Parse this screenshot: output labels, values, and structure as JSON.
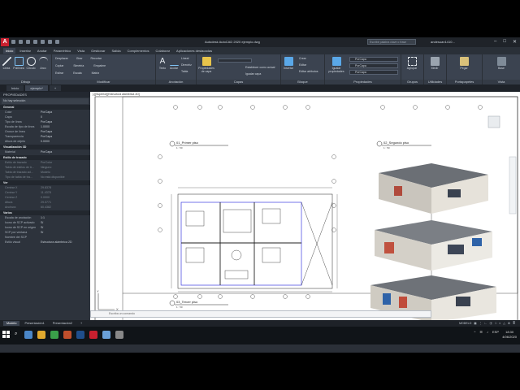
{
  "window": {
    "logo": "A",
    "title": "Autodesk AutoCAD 2020   ejemplo.dwg",
    "search_placeholder": "Escribir palabra clave o frase",
    "user": "andesuan1410...",
    "winbtns": [
      "–",
      "□",
      "✕"
    ]
  },
  "ribbon_tabs": [
    "Inicio",
    "Insertar",
    "Anotar",
    "Paramétrico",
    "Vista",
    "Gestionar",
    "Salida",
    "Complementos",
    "Colaborar",
    "Aplicaciones destacadas"
  ],
  "ribbon": {
    "dibujo": {
      "title": "Dibujo",
      "buttons": [
        "Línea",
        "Polilínea",
        "Círculo",
        "Arco"
      ]
    },
    "modificar": {
      "title": "Modificar",
      "rows": [
        [
          "Desplazar",
          "Girar",
          "Recortar"
        ],
        [
          "Copiar",
          "Simetría",
          "Empalme"
        ],
        [
          "Estirar",
          "Escala",
          "Matriz"
        ]
      ]
    },
    "anotacion": {
      "title": "Anotación",
      "buttons": [
        "Texto",
        "Acotar"
      ],
      "rows": [
        "Lineal",
        "Directriz",
        "Tabla"
      ]
    },
    "capas": {
      "title": "Capas",
      "big": "Propiedades de capa",
      "rows": [
        "Establecer como actual",
        "Igualar capa"
      ]
    },
    "bloque": {
      "title": "Bloque",
      "big": "Insertar",
      "rows": [
        "Crear",
        "Editar",
        "Editar atributos"
      ]
    },
    "propiedades": {
      "title": "Propiedades",
      "big": "Igualar propiedades",
      "values": [
        "PorCapa",
        "PorCapa",
        "PorCapa"
      ]
    },
    "grupos": {
      "title": "Grupos",
      "big": "Agrupar"
    },
    "utilidades": {
      "title": "Utilidades",
      "big": "Medir"
    },
    "portapapeles": {
      "title": "Portapapeles",
      "big": "Pegar"
    },
    "vista": {
      "title": "Vista",
      "big": "Base"
    }
  },
  "doc_tabs": [
    "Inicio",
    "ejemplo*",
    "+"
  ],
  "properties": {
    "header": "PROPIEDADES",
    "selection": "No hay selección",
    "sections": [
      {
        "name": "General",
        "rows": [
          [
            "Color",
            "PorCapa"
          ],
          [
            "Capa",
            "0"
          ],
          [
            "Tipo de línea",
            "PorCapa"
          ],
          [
            "Escala de tipo de línea",
            "1.0000"
          ],
          [
            "Grosor de línea",
            "PorCapa"
          ],
          [
            "Transparencia",
            "PorCapa"
          ],
          [
            "Altura de objeto",
            "0.0000"
          ]
        ]
      },
      {
        "name": "Visualización 3D",
        "rows": [
          [
            "Material",
            "PorCapa"
          ]
        ]
      },
      {
        "name": "Estilo de trazado",
        "rows": [
          [
            "Estilo de trazado",
            "PorColor"
          ],
          [
            "Tabla de estilos de tr...",
            "Ninguno"
          ],
          [
            "Tabla de trazado ad...",
            "Modelo"
          ],
          [
            "Tipo de tabla de tra...",
            "No está disponible"
          ]
        ]
      },
      {
        "name": "Ver",
        "rows": [
          [
            "Centrar X",
            "29.8378"
          ],
          [
            "Centrar Y",
            "11.4378"
          ],
          [
            "Centrar Z",
            "0.0000"
          ],
          [
            "Altura",
            "29.0771"
          ],
          [
            "Anchura",
            "60.4382"
          ]
        ]
      },
      {
        "name": "Varios",
        "rows": [
          [
            "Escala de anotación",
            "1:1"
          ],
          [
            "Icono de SCP activado",
            "Sí"
          ],
          [
            "Icono de SCP en origen",
            "Sí"
          ],
          [
            "SCP por ventana",
            "Sí"
          ],
          [
            "Nombre del SCP",
            ""
          ],
          [
            "Estilo visual",
            "Estructura alámbrica 2D"
          ]
        ]
      }
    ]
  },
  "canvas": {
    "viewport_label": "[-][Superior][Estructura alámbrica 2D]",
    "plan1": "01_Primer piso",
    "plan2": "02_Segundo piso",
    "plan3": "03_Tercer piso",
    "scale": "1 : 50",
    "axis_x": "X",
    "axis_y": "Y"
  },
  "command": {
    "placeholder": "Escriba un comando"
  },
  "layout_tabs": [
    "Modelo",
    "Presentación1",
    "Presentación2",
    "+"
  ],
  "status": {
    "model": "MODELO"
  },
  "taskbar": {
    "time": "18:30",
    "date": "4/06/2020",
    "lang": "ESP"
  },
  "colors": {
    "accent": "#c8202f",
    "ribbon": "#3b4350",
    "dark": "#2b3038"
  }
}
